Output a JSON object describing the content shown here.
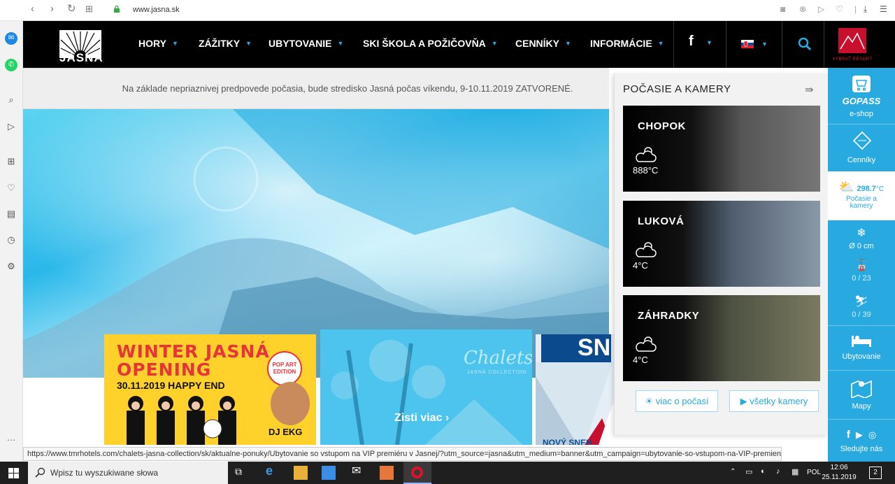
{
  "browser": {
    "url": "www.jasna.sk",
    "nav_back": "‹",
    "nav_forward": "›",
    "reload": "↻",
    "tabs_grid": "⊞"
  },
  "site": {
    "logo_text": "JASNÁ",
    "nav": [
      "HORY",
      "ZÁŽITKY",
      "UBYTOVANIE",
      "SKI ŠKOLA A POŽIČOVŇA",
      "CENNÍKY",
      "INFORMÁCIE"
    ],
    "facebook": "f",
    "resort_label": "VYBRAŤ RESORT"
  },
  "notice": "Na základe nepriaznivej predpovede počasia, bude stredisko Jasná počas víkendu, 9-10.11.2019 ZATVORENÉ.",
  "cards": {
    "winter_title_1": "WINTER JASNÁ",
    "winter_title_2": "OPENING",
    "winter_date": "30.11.2019 HAPPY END",
    "pop_art": "POP ART EDITION",
    "dj": "DJ EKG",
    "chalet_brand": "Chalets",
    "chalet_sub": "JASNÁ COLLECTION",
    "chalet_cta": "Zisti viac",
    "snow_big": "SN",
    "snow_text": "NOVÝ SNEH"
  },
  "weather": {
    "title": "POČASIE A KAMERY",
    "cams": [
      {
        "name": "CHOPOK",
        "temp": "888°C"
      },
      {
        "name": "LUKOVÁ",
        "temp": "4°C"
      },
      {
        "name": "ZÁHRADKY",
        "temp": "4°C"
      }
    ],
    "more_weather": "viac o počasí",
    "all_cams": "všetky kamery"
  },
  "rail": {
    "gopass": "GOPASS",
    "eshop": "e-shop",
    "cenniky": "Cenníky",
    "temp_value": "298.7",
    "temp_unit": "°C",
    "weather": "Počasie a kamery",
    "snow": "Ø 0 cm",
    "lifts": "0 / 23",
    "slopes": "0 / 39",
    "ubytovanie": "Ubytovanie",
    "mapy": "Mapy",
    "follow": "Sledujte nás"
  },
  "status_url": "https://www.tmrhotels.com/chalets-jasna-collection/sk/aktualne-ponuky/Ubytovanie so vstupom na VIP premiéru v Jasnej/?utm_source=jasna&utm_medium=banner&utm_campaign=ubytovanie-so-vstupom-na-VIP-premieru",
  "taskbar": {
    "search_placeholder": "Wpisz tu wyszukiwane słowa",
    "lang": "POL",
    "time": "12:06",
    "date": "25.11.2019",
    "notif_count": "2"
  },
  "colors": {
    "accent": "#28a9e0",
    "nav_bg": "#000000",
    "card_yellow": "#ffd12a"
  }
}
